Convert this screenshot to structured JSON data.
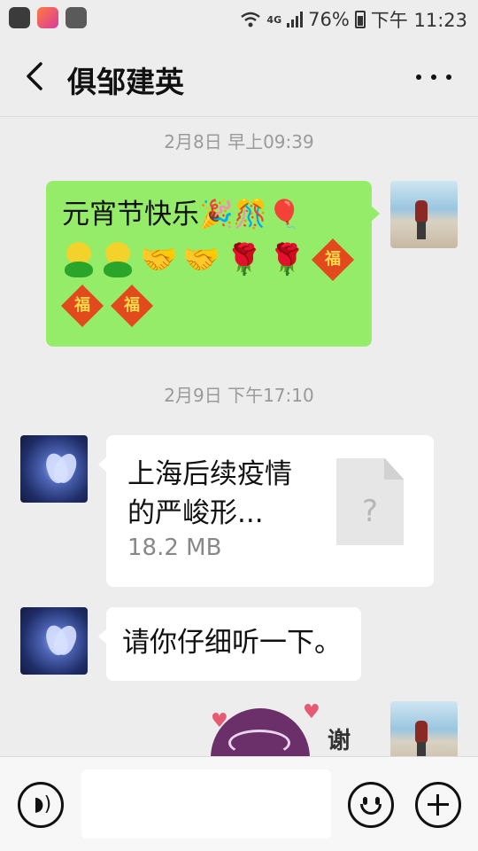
{
  "status_bar": {
    "battery": "76%",
    "time": "下午 11:23",
    "network": "4G",
    "apps": [
      "baidu-icon",
      "todo-app-icon",
      "gallery-app-icon"
    ]
  },
  "header": {
    "title": "俱邹建英",
    "back_icon": "chevron-left-icon",
    "more_icon": "more-dots-icon"
  },
  "messages": [
    {
      "type": "timestamp",
      "text": "2月8日 早上09:39"
    },
    {
      "type": "text",
      "from": "self",
      "text": "元宵节快乐🎉🎊🎈",
      "emojis": [
        "qq-face",
        "qq-face",
        "🤝",
        "🤝",
        "🌹",
        "🌹",
        "福",
        "福",
        "福"
      ]
    },
    {
      "type": "timestamp",
      "text": "2月9日 下午17:10"
    },
    {
      "type": "file",
      "from": "other",
      "file_name": "上海后续疫情的严峻形...",
      "file_size": "18.2 MB"
    },
    {
      "type": "text",
      "from": "other",
      "text": "请你仔细听一下。"
    },
    {
      "type": "sticker",
      "from": "self",
      "text": "谢"
    }
  ],
  "input_bar": {
    "placeholder": "",
    "voice_icon": "voice-icon",
    "emoji_icon": "emoji-icon",
    "plus_icon": "plus-icon"
  },
  "colors": {
    "background": "#ededed",
    "self_bubble": "#95ec69",
    "other_bubble": "#ffffff",
    "timestamp": "#9a9a9a"
  }
}
